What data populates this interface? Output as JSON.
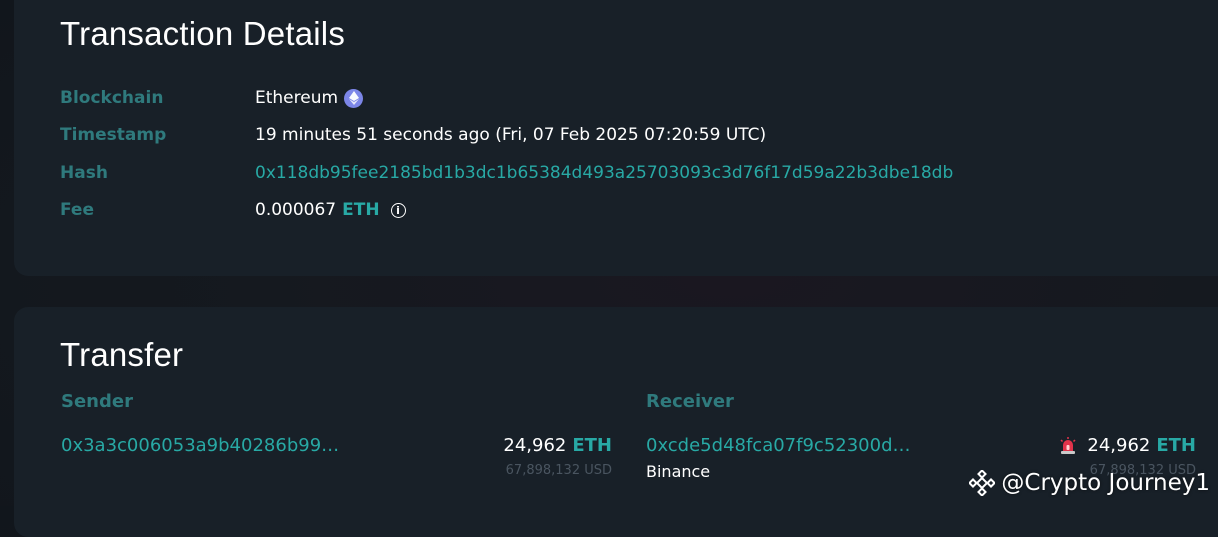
{
  "details": {
    "title": "Transaction Details",
    "rows": {
      "blockchain": {
        "label": "Blockchain",
        "value": "Ethereum",
        "icon": "ethereum-icon"
      },
      "timestamp": {
        "label": "Timestamp",
        "value": "19 minutes 51 seconds ago (Fri, 07 Feb 2025 07:20:59 UTC)"
      },
      "hash": {
        "label": "Hash",
        "value": "0x118db95fee2185bd1b3dc1b65384d493a25703093c3d76f17d59a22b3dbe18db"
      },
      "fee": {
        "label": "Fee",
        "value": "0.000067",
        "unit": "ETH",
        "icon": "info-icon"
      }
    }
  },
  "transfer": {
    "title": "Transfer",
    "sender": {
      "heading": "Sender",
      "address": "0x3a3c006053a9b40286b99…",
      "amount": "24,962",
      "unit": "ETH",
      "usd": "67,898,132 USD"
    },
    "receiver": {
      "heading": "Receiver",
      "address": "0xcde5d48fca07f9c52300d…",
      "entity": "Binance",
      "amount": "24,962",
      "unit": "ETH",
      "usd": "67,898,132 USD",
      "icon": "alarm-siren-icon"
    }
  },
  "watermark": {
    "text": "@Crypto Journey1",
    "icon": "binance-logo-icon"
  },
  "colors": {
    "background": "#131920",
    "card": "#182028",
    "label": "#2f7a7d",
    "link": "#28a9a5",
    "ethereum_badge": "#7c86e8",
    "alarm": "#e0334a"
  }
}
